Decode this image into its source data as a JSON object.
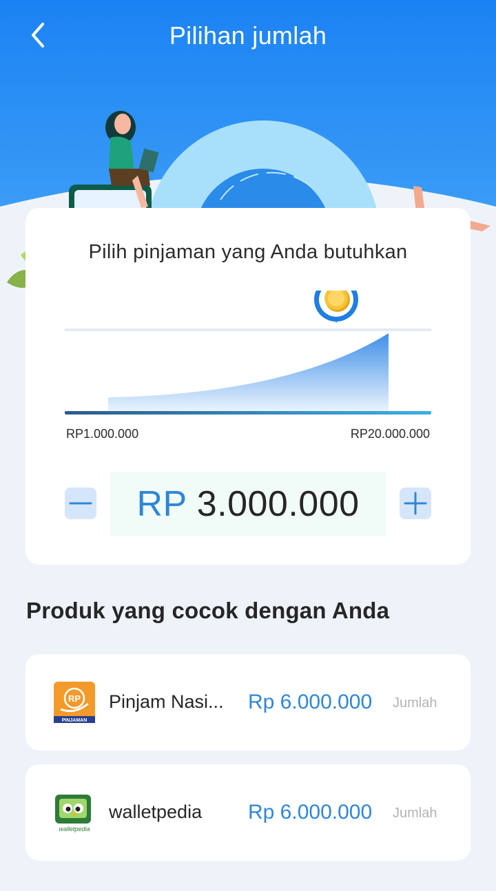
{
  "header": {
    "title": "Pilihan jumlah",
    "back_icon": "chevron-left-icon"
  },
  "colors": {
    "header_blue": "#1f86f2",
    "accent_blue": "#2f86d6",
    "page_bg": "#eef3fa"
  },
  "loan_card": {
    "heading": "Pilih pinjaman yang Anda butuhkan",
    "min_label": "RP1.000.000",
    "max_label": "RP20.000.000",
    "slider_value_fraction": 0.75,
    "currency": "RP",
    "amount": "3.000.000",
    "minus_icon": "minus-icon",
    "plus_icon": "plus-icon",
    "marker_icon": "coin-icon"
  },
  "products_section": {
    "title": "Produk yang cocok dengan Anda",
    "items": [
      {
        "name": "Pinjam Nasi...",
        "amount": "Rp 6.000.000",
        "link_label": "Jumlah",
        "logo_icon": "pinjam-nasional-logo-icon",
        "logo_text": "RP",
        "logo_caption": "PINJAMAN"
      },
      {
        "name": "walletpedia",
        "amount": "Rp 6.000.000",
        "link_label": "Jumlah",
        "logo_icon": "walletpedia-logo-icon",
        "logo_caption": "walletpedia"
      }
    ]
  }
}
